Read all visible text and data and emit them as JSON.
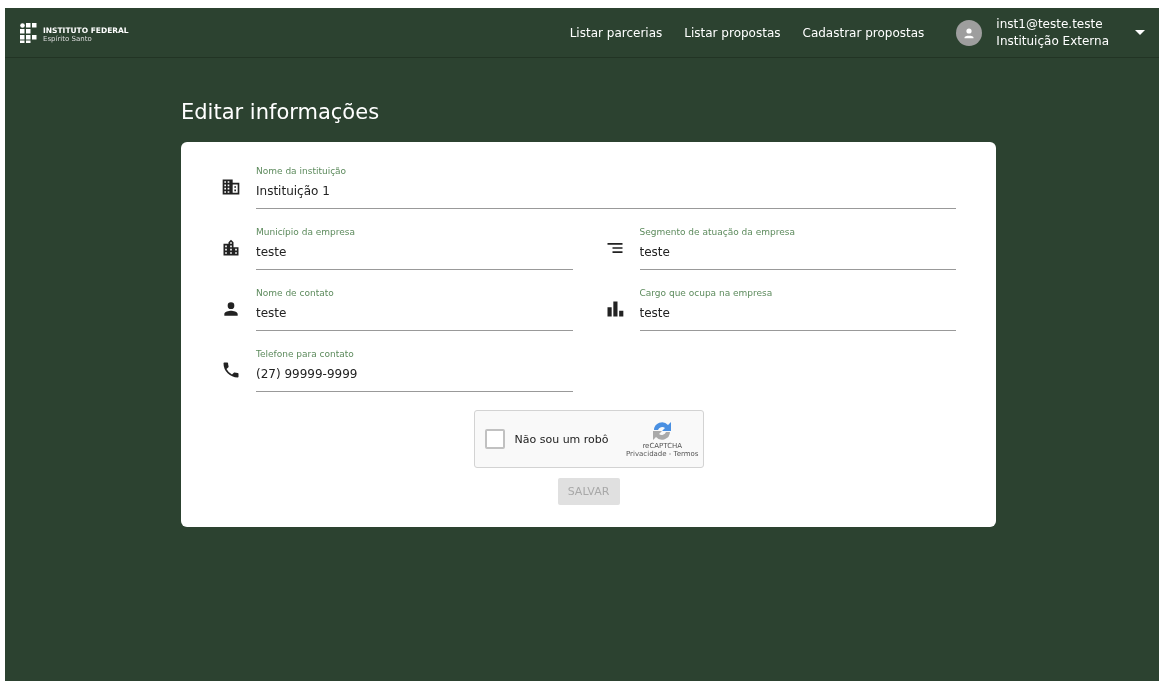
{
  "logo": {
    "name": "INSTITUTO FEDERAL",
    "subtitle": "Espírito Santo"
  },
  "nav": [
    "Listar parcerias",
    "Listar propostas",
    "Cadastrar propostas"
  ],
  "user": {
    "email": "inst1@teste.teste",
    "role": "Instituição Externa"
  },
  "page_title": "Editar informações",
  "fields": [
    {
      "label": "Nome da instituição",
      "value": "Instituição 1",
      "kind": "building",
      "wide": true
    },
    {
      "label": "Município da empresa",
      "value": "teste",
      "kind": "city",
      "wide": false
    },
    {
      "label": "Segmento de atuação da empresa",
      "value": "teste",
      "kind": "sort",
      "wide": false
    },
    {
      "label": "Nome de contato",
      "value": "teste",
      "kind": "person",
      "wide": false
    },
    {
      "label": "Cargo que ocupa na empresa",
      "value": "teste",
      "kind": "bars",
      "wide": false
    },
    {
      "label": "Telefone para contato",
      "value": "(27) 99999-9999",
      "kind": "phone",
      "wide": false
    }
  ],
  "captcha": {
    "label": "Não sou um robô",
    "checked": false,
    "brand": "reCAPTCHA",
    "links": "Privacidade - Termos"
  },
  "save_button": {
    "label": "SALVAR",
    "disabled": true
  }
}
